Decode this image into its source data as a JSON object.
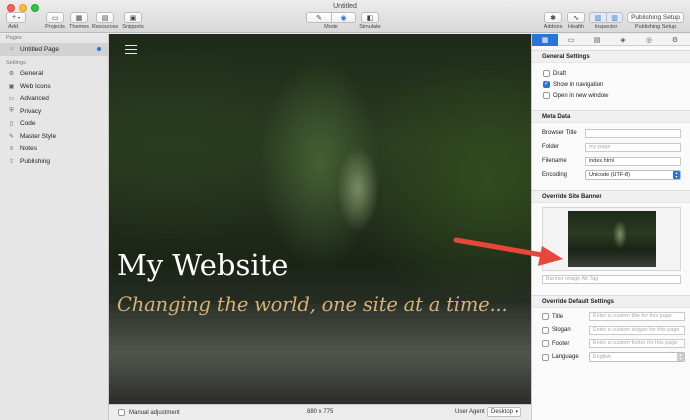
{
  "window": {
    "title": "Untitled"
  },
  "toolbar": {
    "add_label": "Add",
    "add_glyph": "+",
    "projects_label": "Projects",
    "themes_label": "Themes",
    "resources_label": "Resources",
    "snippets_label": "Snippets",
    "mode_label": "Mode",
    "simulate_label": "Simulate",
    "addons_label": "Addons",
    "health_label": "Health",
    "inspector_label": "Inspector",
    "publishing_button": "Publishing Setup",
    "publishing_label": "Publishing Setup"
  },
  "sidebar": {
    "pages_heading": "Pages",
    "pages": [
      {
        "label": "Untitled Page",
        "icon": "page-icon"
      }
    ],
    "settings_heading": "Settings",
    "settings": [
      {
        "label": "General",
        "icon": "gear-icon"
      },
      {
        "label": "Web Icons",
        "icon": "image-icon"
      },
      {
        "label": "Advanced",
        "icon": "folder-icon"
      },
      {
        "label": "Privacy",
        "icon": "lock-icon"
      },
      {
        "label": "Code",
        "icon": "document-icon"
      },
      {
        "label": "Master Style",
        "icon": "brush-icon"
      },
      {
        "label": "Notes",
        "icon": "notes-icon"
      },
      {
        "label": "Publishing",
        "icon": "upload-icon"
      }
    ]
  },
  "canvas": {
    "site_title": "My Website",
    "site_tagline": "Changing the world, one site at a time..."
  },
  "statusbar": {
    "manual_adjustment": "Manual adjustment",
    "size": "880 x 775",
    "user_agent_label": "User Agent",
    "user_agent_value": "Desktop"
  },
  "inspector": {
    "general_settings": {
      "heading": "General Settings",
      "draft": {
        "label": "Draft",
        "checked": false
      },
      "show_in_navigation": {
        "label": "Show in navigation",
        "checked": true
      },
      "open_in_new_window": {
        "label": "Open in new window",
        "checked": false
      }
    },
    "meta_data": {
      "heading": "Meta Data",
      "browser_title": {
        "label": "Browser Title",
        "value": ""
      },
      "folder": {
        "label": "Folder",
        "placeholder": "my-page"
      },
      "filename": {
        "label": "Filename",
        "value": "index.html"
      },
      "encoding": {
        "label": "Encoding",
        "value": "Unicode (UTF-8)"
      }
    },
    "override_site_banner": {
      "heading": "Override Site Banner",
      "alt_placeholder": "Banner image Alt Tag"
    },
    "override_default_settings": {
      "heading": "Override Default Settings",
      "title": {
        "label": "Title",
        "placeholder": "Enter a custom title for this page"
      },
      "slogan": {
        "label": "Slogan",
        "placeholder": "Enter a custom slogan for this page"
      },
      "footer": {
        "label": "Footer",
        "placeholder": "Enter a custom footer for this page"
      },
      "language": {
        "label": "Language",
        "value": "English"
      }
    }
  },
  "colors": {
    "accent": "#2a73d8",
    "tagline": "#d6b27a",
    "arrow": "#e8463b"
  }
}
